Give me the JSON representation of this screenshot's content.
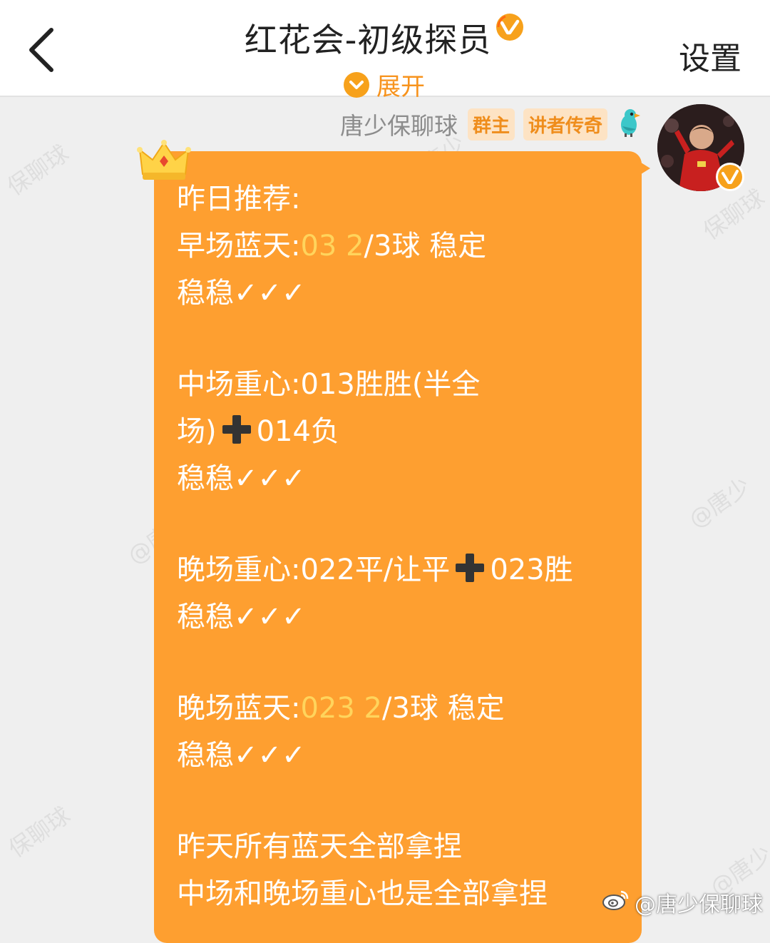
{
  "header": {
    "back_icon": "chevron-left-icon",
    "title": "红花会-初级探员",
    "title_badge_icon": "verified-v-icon",
    "expand_label": "展开",
    "expand_icon": "chevron-down-icon",
    "settings_label": "设置"
  },
  "sender": {
    "name": "唐少保聊球",
    "badges": [
      "群主",
      "讲者传奇"
    ],
    "badge_icon": "parrot-icon",
    "avatar_verified_icon": "verified-v-icon"
  },
  "message": {
    "crown_icon": "crown-icon",
    "plus_icon": "heavy-plus-icon",
    "heading": "昨日推荐:",
    "block1": {
      "prefix": "早场蓝天:",
      "highlight": "03 2",
      "suffix": "/3球 稳定",
      "result": "稳稳✓✓✓"
    },
    "block2": {
      "line1": "中场重心:013胜胜(半全",
      "line2_prefix": "场)",
      "line2_suffix": "014负",
      "result": "稳稳✓✓✓"
    },
    "block3": {
      "line1_prefix": "晚场重心:022平/让平",
      "line1_suffix": "023胜",
      "result": "稳稳✓✓✓"
    },
    "block4": {
      "prefix": "晚场蓝天:",
      "highlight": "023 2",
      "suffix": "/3球 稳定",
      "result": "稳稳✓✓✓"
    },
    "summary": [
      "昨天所有蓝天全部拿捏",
      "中场和晚场重心也是全部拿捏"
    ]
  },
  "watermarks": [
    "保聊球",
    "@唐少",
    "保聊球",
    "@唐",
    "@唐少",
    "@唐少",
    "保聊球"
  ],
  "footer_watermark": "@唐少保聊球",
  "colors": {
    "bubble": "#fe9f30",
    "highlight": "#ffd45c",
    "accent": "#f7a11b"
  }
}
